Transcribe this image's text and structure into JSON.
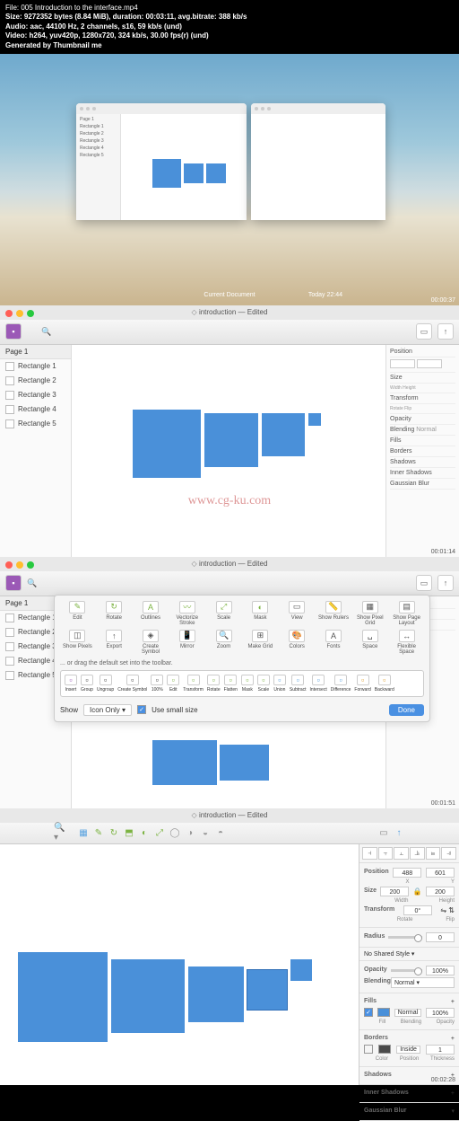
{
  "metadata": {
    "file": "File: 005 Introduction to the interface.mp4",
    "size": "Size: 9272352 bytes (8.84 MiB), duration: 00:03:11, avg.bitrate: 388 kb/s",
    "audio": "Audio: aac, 44100 Hz, 2 channels, s16, 59 kb/s (und)",
    "video": "Video: h264, yuv420p, 1280x720, 324 kb/s, 30.00 fps(r) (und)",
    "generated": "Generated by Thumbnail me"
  },
  "panel1": {
    "dock_current": "Current Document",
    "time_label": "Today 22:44",
    "timecode": "00:00:37",
    "mini_layers": [
      "Page 1",
      "Rectangle 1",
      "Rectangle 2",
      "Rectangle 3",
      "Rectangle 4",
      "Rectangle 5"
    ]
  },
  "panel2": {
    "title": "introduction — Edited",
    "page": "Page 1",
    "layers": [
      "Rectangle 1",
      "Rectangle 2",
      "Rectangle 3",
      "Rectangle 4",
      "Rectangle 5"
    ],
    "inspector": {
      "position": "Position",
      "size": "Size",
      "width": "Width",
      "height": "Height",
      "transform": "Transform",
      "rotate": "Rotate",
      "flip": "Flip",
      "opacity": "Opacity",
      "blending": "Blending",
      "blending_val": "Normal",
      "fills": "Fills",
      "borders": "Borders",
      "shadows": "Shadows",
      "inner_shadows": "Inner Shadows",
      "gaussian": "Gaussian Blur"
    },
    "timecode": "00:01:14"
  },
  "watermark": "www.cg-ku.com",
  "panel3": {
    "title": "introduction — Edited",
    "page": "Page 1",
    "layers": [
      "Rectangle 1",
      "Rectangle 2",
      "Rectangle 3",
      "Rectangle 4",
      "Rectangle 5"
    ],
    "icons_row1": [
      "Edit",
      "Rotate",
      "Outlines",
      "Vectorize Stroke",
      "Scale",
      "Mask",
      "View",
      "Show Rulers"
    ],
    "icons_row2": [
      "Show Pixel Grid",
      "Show Page Layout",
      "Show Pixels",
      "Export",
      "Create Symbol",
      "Mirror",
      "Zoom",
      "Make Grid"
    ],
    "icons_row3": [
      "Colors",
      "Fonts",
      "Space",
      "Flexible Space"
    ],
    "drag_hint": "... or drag the default set into the toolbar.",
    "default_set": [
      "Insert",
      "Group",
      "Ungroup",
      "Create Symbol",
      "100%",
      "Edit",
      "Transform",
      "Rotate",
      "Flatten",
      "Mask",
      "Scale",
      "Union",
      "Subtract",
      "Intersect",
      "Difference",
      "Forward",
      "Backward"
    ],
    "show_label": "Show",
    "show_value": "Icon Only",
    "small_size": "Use small size",
    "done": "Done",
    "timecode": "00:01:51"
  },
  "panel4": {
    "title": "introduction — Edited",
    "inspector": {
      "position": "Position",
      "x": "488",
      "y": "601",
      "xl": "X",
      "yl": "Y",
      "size": "Size",
      "w": "200",
      "h": "200",
      "wl": "Width",
      "hl": "Height",
      "transform": "Transform",
      "deg": "0°",
      "rotate": "Rotate",
      "flip": "Flip",
      "radius": "Radius",
      "radius_val": "0",
      "no_style": "No Shared Style",
      "opacity": "Opacity",
      "opacity_val": "100%",
      "blending": "Blending",
      "blending_val": "Normal",
      "fills": "Fills",
      "fill_mode": "Normal",
      "fill_opacity": "100%",
      "fill_l": "Fill",
      "blend_l": "Blending",
      "opac_l": "Opacity",
      "borders": "Borders",
      "border_mode": "Inside",
      "border_thick": "1",
      "color_l": "Color",
      "pos_l": "Position",
      "thick_l": "Thickness",
      "shadows": "Shadows",
      "inner_shadows": "Inner Shadows",
      "gaussian": "Gaussian Blur"
    },
    "timecode": "00:02:28"
  }
}
